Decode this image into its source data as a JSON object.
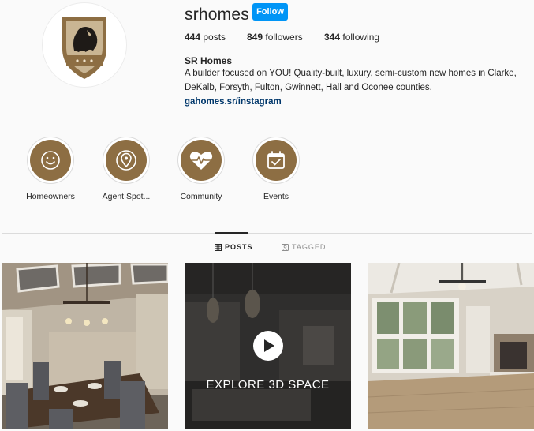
{
  "profile": {
    "username": "srhomes",
    "follow_label": "Follow",
    "posts_count": "444",
    "posts_label": "posts",
    "followers_count": "849",
    "followers_label": "followers",
    "following_count": "344",
    "following_label": "following",
    "display_name": "SR Homes",
    "bio_line1": "A builder focused on YOU! Quality-built, luxury, semi-custom new homes in Clarke,",
    "bio_line2": "DeKalb, Forsyth, Fulton, Gwinnett, Hall and Oconee counties.",
    "link": "gahomes.sr/instagram"
  },
  "highlights": [
    {
      "label": "Homeowners",
      "icon": "smiley-icon"
    },
    {
      "label": "Agent Spot...",
      "icon": "location-pin-icon"
    },
    {
      "label": "Community",
      "icon": "heart-pulse-icon"
    },
    {
      "label": "Events",
      "icon": "calendar-check-icon"
    }
  ],
  "tabs": {
    "posts": "POSTS",
    "tagged": "TAGGED"
  },
  "posts": [
    {
      "kind": "dining-room-photo"
    },
    {
      "kind": "video",
      "overlay_text": "EXPLORE 3D SPACE"
    },
    {
      "kind": "living-room-photo"
    }
  ],
  "colors": {
    "brand": "#8d6e43",
    "follow_button": "#0095f6",
    "link": "#00376b"
  }
}
